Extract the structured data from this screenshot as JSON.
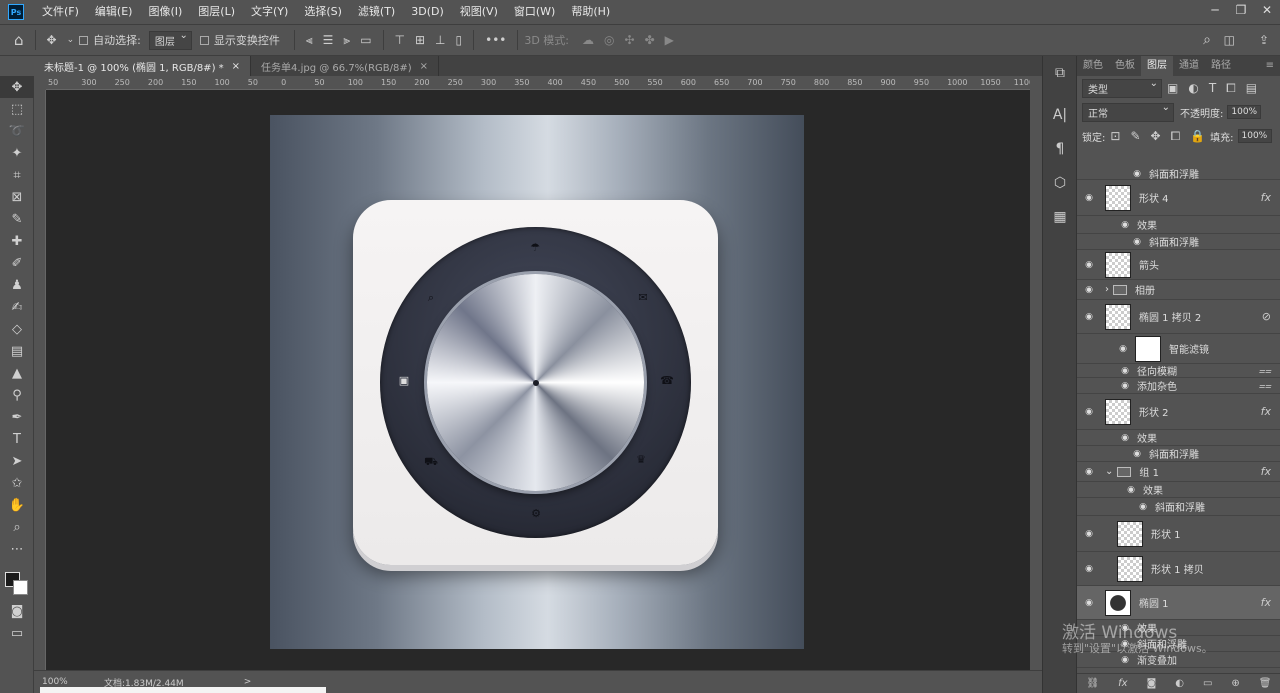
{
  "menubar": {
    "logo": "Ps",
    "items": [
      "文件(F)",
      "编辑(E)",
      "图像(I)",
      "图层(L)",
      "文字(Y)",
      "选择(S)",
      "滤镜(T)",
      "3D(D)",
      "视图(V)",
      "窗口(W)",
      "帮助(H)"
    ]
  },
  "options": {
    "auto_select_label": "自动选择:",
    "auto_select_value": "图层",
    "transform_label": "显示变换控件",
    "mode_3d": "3D 模式:",
    "more": "•••"
  },
  "doc_tabs": [
    {
      "label": "未标题-1 @ 100% (椭圆 1, RGB/8#) *",
      "close": "×"
    },
    {
      "label": "任务单4.jpg @ 66.7%(RGB/8#)",
      "close": "×"
    }
  ],
  "ruler_top": [
    "50",
    "300",
    "250",
    "200",
    "150",
    "100",
    "50",
    "0",
    "50",
    "100",
    "150",
    "200",
    "250",
    "300",
    "350",
    "400",
    "450",
    "500",
    "550",
    "600",
    "650",
    "700",
    "750",
    "800",
    "850",
    "900",
    "950",
    "1000",
    "1050",
    "1100"
  ],
  "status": {
    "zoom": "100%",
    "doc": "文档:1.83M/2.44M",
    "arrow": ">"
  },
  "panel": {
    "tabs": [
      "颜色",
      "色板",
      "图层",
      "通道",
      "路径"
    ],
    "filter_value": "类型",
    "blend_mode": "正常",
    "opacity_label": "不透明度:",
    "opacity_value": "100%",
    "lock_label": "锁定:",
    "fill_label": "填充:",
    "fill_value": "100%"
  },
  "layers": [
    {
      "name": "斜面和浮雕",
      "kind": "sub"
    },
    {
      "name": "形状 4",
      "kind": "layer",
      "fx": "fx"
    },
    {
      "name": "效果",
      "kind": "sub"
    },
    {
      "name": "斜面和浮雕",
      "kind": "sub"
    },
    {
      "name": "箭头",
      "kind": "layer"
    },
    {
      "name": "相册",
      "kind": "group"
    },
    {
      "name": "椭圆 1 拷贝 2",
      "kind": "layer"
    },
    {
      "name": "智能滤镜",
      "kind": "smart"
    },
    {
      "name": "径向模糊",
      "kind": "sub"
    },
    {
      "name": "添加杂色",
      "kind": "sub"
    },
    {
      "name": "形状 2",
      "kind": "layer",
      "fx": "fx"
    },
    {
      "name": "效果",
      "kind": "sub"
    },
    {
      "name": "斜面和浮雕",
      "kind": "sub"
    },
    {
      "name": "组 1",
      "kind": "group",
      "fx": "fx"
    },
    {
      "name": "效果",
      "kind": "sub"
    },
    {
      "name": "斜面和浮雕",
      "kind": "sub"
    },
    {
      "name": "形状 1",
      "kind": "layer"
    },
    {
      "name": "形状 1 拷贝",
      "kind": "layer"
    },
    {
      "name": "椭圆 1",
      "kind": "layer",
      "fx": "fx"
    },
    {
      "name": "效果",
      "kind": "sub"
    },
    {
      "name": "斜面和浮雕",
      "kind": "sub"
    },
    {
      "name": "渐变叠加",
      "kind": "sub"
    }
  ],
  "watermark": {
    "line1": "激活 Windows",
    "line2": "转到\"设置\"以激活 Windows。"
  },
  "icons": {
    "umbrella": "☂",
    "mail": "✉",
    "phone": "☎",
    "crown": "♛",
    "gear": "⚙",
    "image": "▣",
    "search": "⌕",
    "cart": "⛟"
  }
}
